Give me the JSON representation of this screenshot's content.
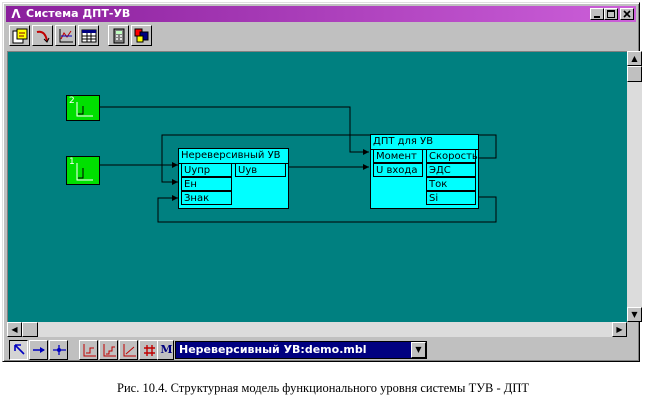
{
  "window": {
    "title": "Система ДПТ-УВ",
    "app_icon": "lambda-logo-icon",
    "buttons": [
      "minimize-icon",
      "maximize-icon",
      "close-icon"
    ]
  },
  "toolbar": {
    "icons": [
      "open-model-icon",
      "connect-curve-icon",
      "graph-icon",
      "table-icon",
      "calculator-icon",
      "blocks-icon"
    ]
  },
  "diagram": {
    "sources": [
      {
        "number": "2"
      },
      {
        "number": "1"
      }
    ],
    "blocks": [
      {
        "title": "Нереверсивный УВ",
        "inputs": [
          "Uупр",
          "Ен",
          "Знак"
        ],
        "outputs": [
          "Uув"
        ]
      },
      {
        "title": "ДПТ для УВ",
        "inputs": [
          "Момент",
          "U входа"
        ],
        "outputs": [
          "Скорость",
          "ЭДС",
          "Ток",
          "Si"
        ]
      }
    ]
  },
  "bottom_toolbar": {
    "tools": [
      "select-arrow-icon",
      "link-arrow-icon",
      "node-icon"
    ],
    "graphs": [
      "graph-1-icon",
      "graph-2-icon",
      "graph-3-icon",
      "grid-icon"
    ],
    "m_label": "M",
    "model_select": "Нереверсивный УВ:demo.mbl"
  },
  "caption": "Рис. 10.4. Структурная модель функционального уровня системы ТУВ - ДПТ",
  "colors": {
    "title_bar": "#8a1f9c",
    "canvas": "#008080",
    "block": "#00ffff",
    "source": "#00e000",
    "combo": "#000080"
  }
}
